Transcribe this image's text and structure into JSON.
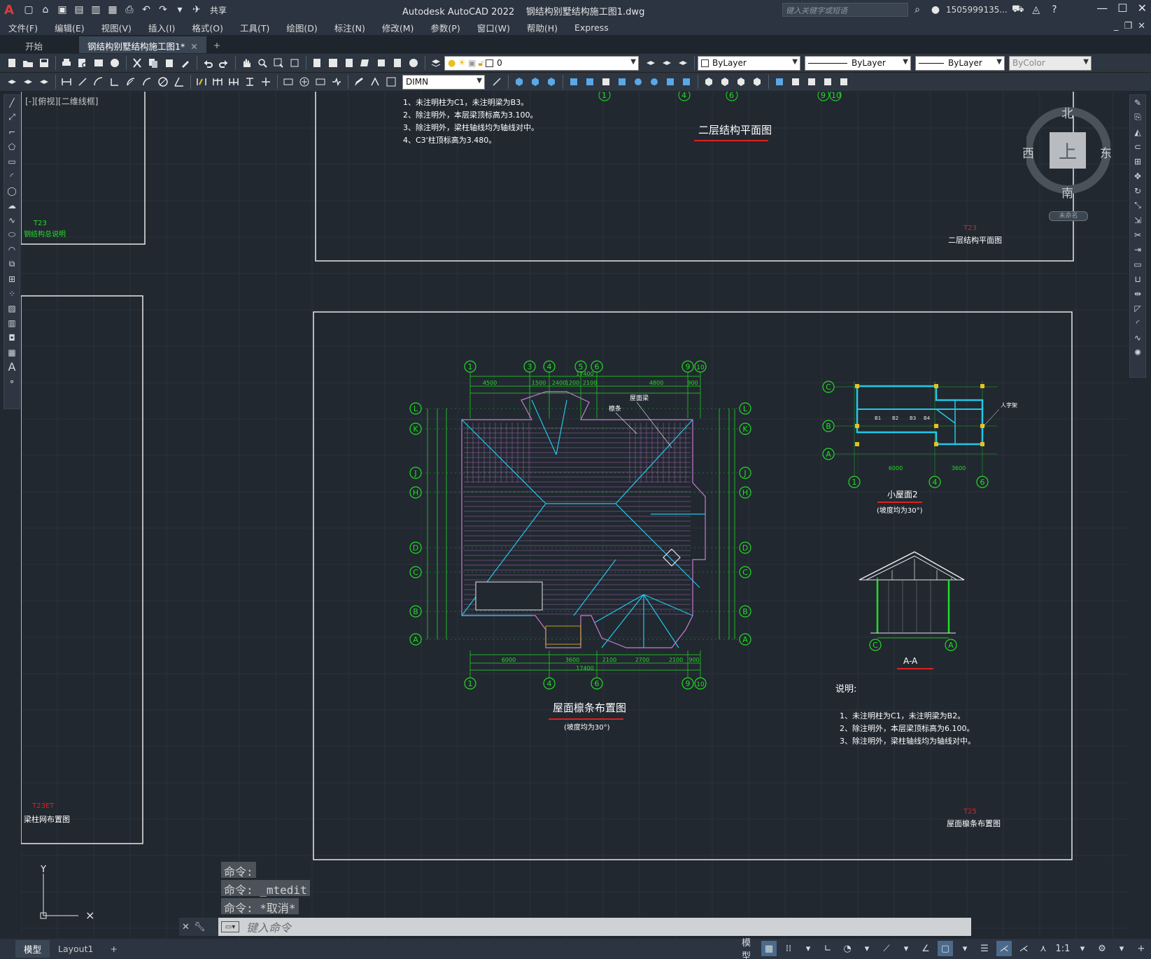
{
  "title_bar": {
    "app_name": "Autodesk AutoCAD 2022",
    "file_name": "钢结构别墅结构施工图1.dwg",
    "share_label": "共享",
    "search_placeholder": "键入关键字或短语",
    "user_name": "1505999135..."
  },
  "menu": [
    "文件(F)",
    "编辑(E)",
    "视图(V)",
    "插入(I)",
    "格式(O)",
    "工具(T)",
    "绘图(D)",
    "标注(N)",
    "修改(M)",
    "参数(P)",
    "窗口(W)",
    "帮助(H)",
    "Express"
  ],
  "tabs": {
    "start": "开始",
    "active": "钢结构别墅结构施工图1*"
  },
  "toolbar": {
    "layer_value": "0",
    "color_value": "ByLayer",
    "linetype_value": "ByLayer",
    "lineweight_value": "ByLayer",
    "plotstyle_value": "ByColor",
    "dimstyle_value": "DIMN"
  },
  "viewport": {
    "label": "[-][俯视][二维线框]"
  },
  "viewcube": {
    "north": "北",
    "south": "南",
    "east": "东",
    "west": "西",
    "top": "上",
    "unnamed": "未命名"
  },
  "drawing": {
    "notes_top": [
      "1、未注明柱为C1，未注明梁为B3。",
      "2、除注明外，本层梁顶标高为3.100。",
      "3、除注明外，梁柱轴线均为轴线对中。",
      "4、C3'柱顶标高为3.480。"
    ],
    "second_floor_title": "二层结构平面图",
    "sheet_t23_no": "T23",
    "sheet_t23_title": "二层结构平面图",
    "left_sheet_top_no": "T23",
    "left_sheet_top_title": "钢结构总说明",
    "left_sheet_bottom_no": "T23ET",
    "left_sheet_bottom_title": "梁柱网布置图",
    "roof_plan_title": "屋面檩条布置图",
    "roof_plan_subtitle": "(坡度均为30°)",
    "small_roof_title": "小屋面2",
    "small_roof_subtitle": "(坡度均为30°)",
    "section_title": "A-A",
    "notes_heading": "说明:",
    "notes_bottom": [
      "1、未注明柱为C1，未注明梁为B2。",
      "2、除注明外，本层梁顶标高为6.100。",
      "3、除注明外，梁柱轴线均为轴线对中。"
    ],
    "sheet_t25_no": "T25",
    "sheet_t25_title": "屋面檩条布置图",
    "axis_top": [
      "1",
      "3",
      "4",
      "5",
      "6",
      "9",
      "10"
    ],
    "axis_bottom": [
      "1",
      "4",
      "6",
      "9",
      "10"
    ],
    "axis_rows": [
      "L",
      "K",
      "J",
      "H",
      "D",
      "C",
      "B",
      "A"
    ],
    "dim_top": [
      "4500",
      "1500",
      "2400",
      "1200",
      "2100",
      "4800",
      "900"
    ],
    "dim_top_total": "17400",
    "dim_bottom": [
      "6000",
      "3600",
      "2100",
      "2700",
      "2100",
      "900"
    ],
    "dim_bottom_total": "17400",
    "small_axis_rows": [
      "C",
      "B",
      "A"
    ],
    "small_axis_cols": [
      "1",
      "4",
      "6"
    ],
    "small_dims": [
      "6000",
      "3600"
    ],
    "label_purlin": "檩条",
    "label_truss": "屋面梁",
    "label_dormer": "人字架"
  },
  "command": {
    "history": [
      "命令:",
      "命令: _mtedit",
      "命令: *取消*"
    ],
    "placeholder": "键入命令"
  },
  "status": {
    "model_tab": "模型",
    "layout_tab": "Layout1",
    "model_label": "模型",
    "scale": "1:1"
  },
  "colors": {
    "background": "#212830",
    "axis_green": "#22dd22",
    "cyan": "#22c8e8",
    "magenta": "#d07ad8",
    "red": "#e02020",
    "white": "#ffffff"
  }
}
